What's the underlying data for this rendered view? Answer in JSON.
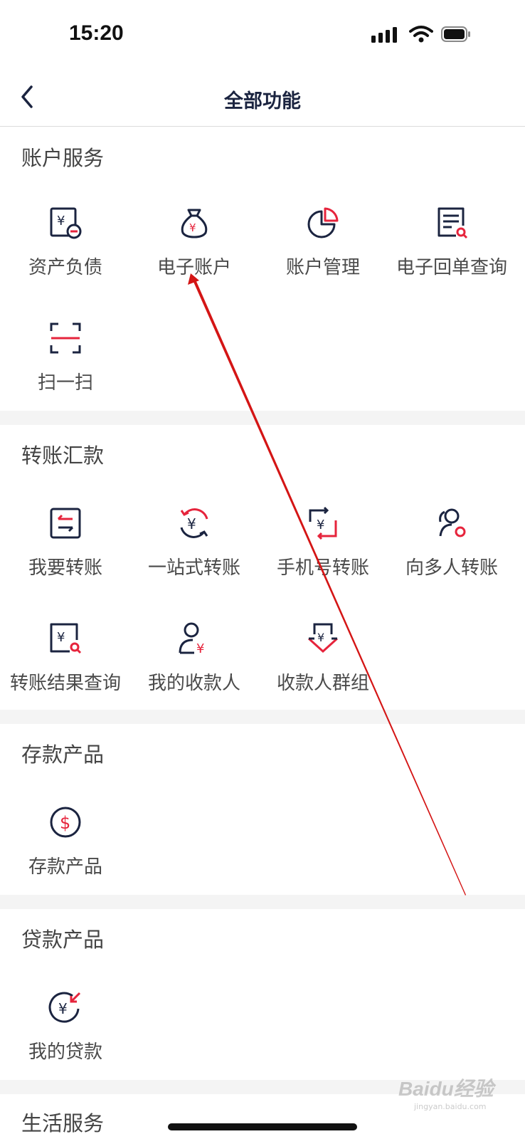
{
  "status_bar": {
    "time": "15:20"
  },
  "nav": {
    "title": "全部功能"
  },
  "sections": [
    {
      "title": "账户服务",
      "items": [
        {
          "label": "资产负债",
          "icon": "asset-liability-icon"
        },
        {
          "label": "电子账户",
          "icon": "money-bag-icon"
        },
        {
          "label": "账户管理",
          "icon": "pie-chart-icon"
        },
        {
          "label": "电子回单查询",
          "icon": "receipt-search-icon"
        },
        {
          "label": "扫一扫",
          "icon": "scan-icon"
        }
      ]
    },
    {
      "title": "转账汇款",
      "items": [
        {
          "label": "我要转账",
          "icon": "transfer-icon"
        },
        {
          "label": "一站式转账",
          "icon": "one-stop-transfer-icon"
        },
        {
          "label": "手机号转账",
          "icon": "phone-transfer-icon"
        },
        {
          "label": "向多人转账",
          "icon": "multi-transfer-icon"
        },
        {
          "label": "转账结果查询",
          "icon": "transfer-result-search-icon"
        },
        {
          "label": "我的收款人",
          "icon": "payee-icon"
        },
        {
          "label": "收款人群组",
          "icon": "payee-group-icon"
        }
      ]
    },
    {
      "title": "存款产品",
      "items": [
        {
          "label": "存款产品",
          "icon": "dollar-coin-icon"
        }
      ]
    },
    {
      "title": "贷款产品",
      "items": [
        {
          "label": "我的贷款",
          "icon": "loan-icon"
        }
      ]
    },
    {
      "title": "生活服务",
      "items": []
    }
  ],
  "watermark": {
    "text": "Baidu经验",
    "sub": "jingyan.baidu.com"
  },
  "colors": {
    "accent": "#e6243c",
    "dark": "#1b2440",
    "annotation": "#d41515"
  }
}
